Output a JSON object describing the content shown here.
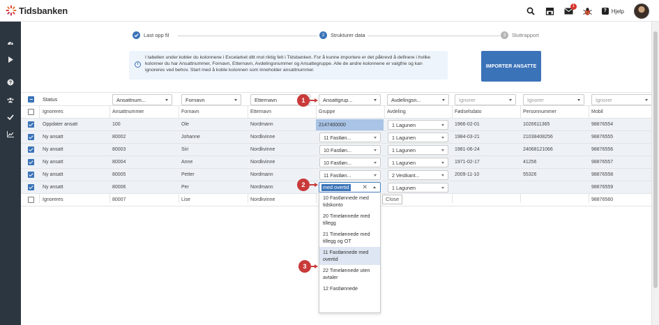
{
  "app": {
    "logo_text": "Tidsbanken",
    "help_label": "Hjelp",
    "notification_count": "1"
  },
  "stepper": {
    "steps": [
      {
        "label": "Last opp fil",
        "state": "done",
        "num": ""
      },
      {
        "label": "Strukturer data",
        "state": "active",
        "num": "2"
      },
      {
        "label": "Sluttrapport",
        "state": "todo",
        "num": "3"
      }
    ]
  },
  "info": {
    "text": "I tabellen under kobler du kolonnene i Excelarket ditt mot riktig felt i Tidsbanken. For å kunne importere er det påkrevd å definere i hvilke kolonner du har Ansattnummer, Fornavn, Etternavn, Avdelingsnummer og Ansattegruppe. Alle de andre kolonnene er valgfrie og kan ignoreres ved behov. Start med å koble kolonnen som inneholder ansattnummer.",
    "icon": "i"
  },
  "import_button": "IMPORTER ANSATTE",
  "table": {
    "mapping_headers": [
      "Status",
      "Ansattnum...",
      "Fornavn",
      "Etternavn",
      "Ansattgrup...",
      "Avdelingsn...",
      "Ignorer",
      "Ignorer",
      "Ignorer"
    ],
    "source_headers": [
      "Ignoreres",
      "Ansattnummer",
      "Fornavn",
      "Etternavn",
      "Gruppe",
      "Avdeling",
      "Fødselsdato",
      "Personnummer",
      "Mobil"
    ],
    "rows": [
      {
        "checked": true,
        "status": "Oppdater ansatt",
        "num": "100",
        "first": "Ole",
        "last": "Nordmann",
        "group": "2147400000",
        "dept": "1 Lagunen",
        "birth": "1966-02-01",
        "pnr": "1026611365",
        "mobile": "98876554"
      },
      {
        "checked": true,
        "status": "Ny ansatt",
        "num": "80002",
        "first": "Johanne",
        "last": "Nordkvinne",
        "group": "11 Fastløn...",
        "dept": "1 Lagunen",
        "birth": "1984-03-21",
        "pnr": "21038408256",
        "mobile": "98876555"
      },
      {
        "checked": true,
        "status": "Ny ansatt",
        "num": "80003",
        "first": "Siri",
        "last": "Nordkvinne",
        "group": "10 Fastløn...",
        "dept": "1 Lagunen",
        "birth": "1981-06-24",
        "pnr": "24068121066",
        "mobile": "98876556"
      },
      {
        "checked": true,
        "status": "Ny ansatt",
        "num": "80004",
        "first": "Anne",
        "last": "Nordkvinne",
        "group": "10 Fastløn...",
        "dept": "1 Lagunen",
        "birth": "1971-02-17",
        "pnr": "41256",
        "mobile": "98876557"
      },
      {
        "checked": true,
        "status": "Ny ansatt",
        "num": "80005",
        "first": "Petter",
        "last": "Nordmann",
        "group": "11 Fastløn...",
        "dept": "2 Vestkant...",
        "birth": "2009-11-10",
        "pnr": "55326",
        "mobile": "98876558"
      },
      {
        "checked": true,
        "status": "Ny ansatt",
        "num": "80006",
        "first": "Per",
        "last": "Nordmann",
        "group": "",
        "dept": "1 Lagunen",
        "birth": "",
        "pnr": "",
        "mobile": "98876559"
      },
      {
        "checked": false,
        "status": "Ignoreres",
        "num": "80007",
        "first": "Lise",
        "last": "Nordkvinne",
        "group": "",
        "dept": "",
        "birth": "",
        "pnr": "",
        "mobile": "98876560"
      }
    ]
  },
  "dropdown": {
    "search_value": "med overtid",
    "clear_symbol": "✕",
    "options": [
      {
        "label": "10 Fastlønnede med tidskonto",
        "highlight": false
      },
      {
        "label": "20 Timelønnede med tillegg",
        "highlight": false
      },
      {
        "label": "21 Timelønnede med tillegg og OT",
        "highlight": false
      },
      {
        "label": "11 Fastlønnede med overtid",
        "highlight": true
      },
      {
        "label": "22 Timelønnede uten avtaler",
        "highlight": false
      },
      {
        "label": "12 Fastlønnede",
        "highlight": false
      }
    ],
    "close_tooltip": "Close"
  },
  "markers": [
    "1",
    "2",
    "3"
  ],
  "colors": {
    "accent": "#3a73b8",
    "sidebar": "#2b3640",
    "marker": "#c93a3a",
    "highlight_cell": "#a9c4e6"
  },
  "icons": {
    "search": "search-icon",
    "store": "store-icon",
    "mail": "mail-icon",
    "bug": "bug-icon",
    "help": "help-icon"
  }
}
